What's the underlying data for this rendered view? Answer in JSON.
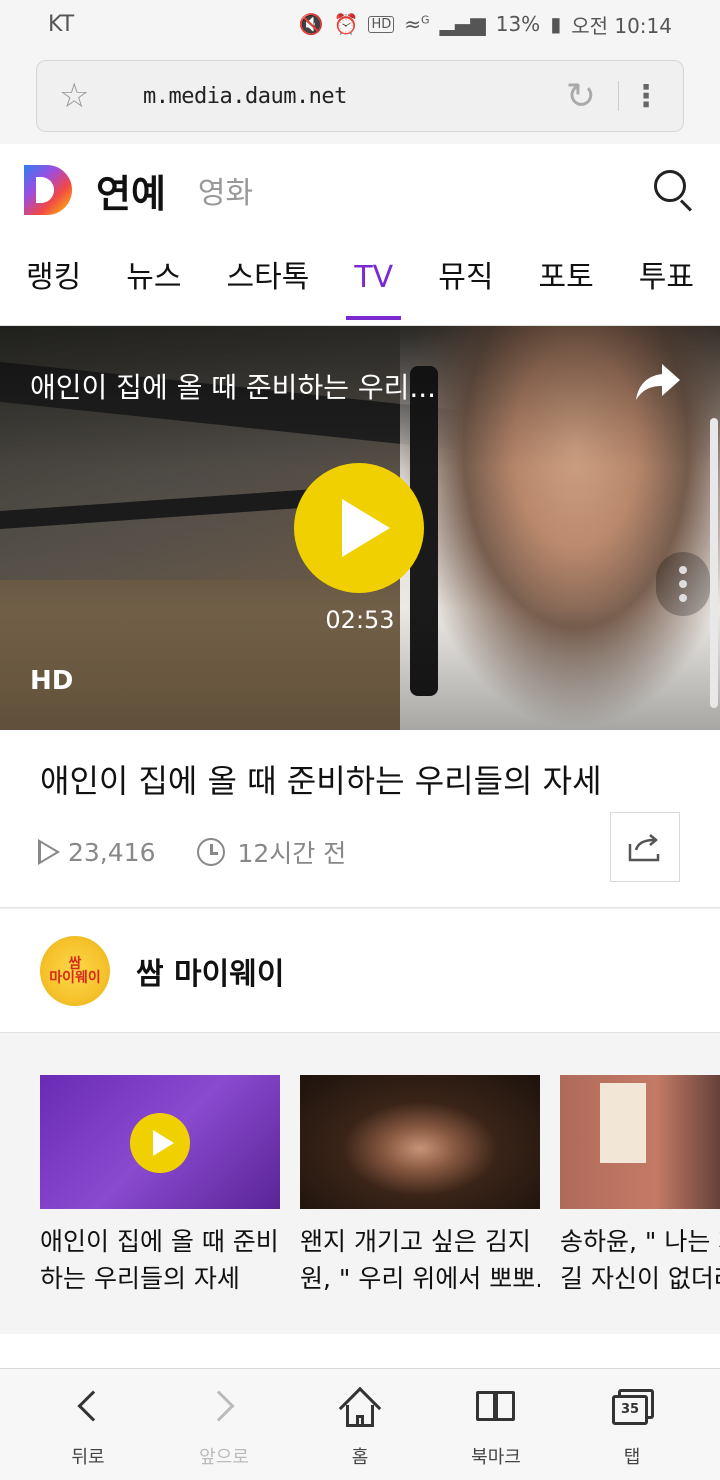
{
  "status_bar": {
    "carrier": "KT",
    "network": "G",
    "battery": "13%",
    "time": "오전 10:14",
    "icons": [
      "mute-icon",
      "alarm-icon",
      "hd-icon",
      "wifi-icon",
      "signal-icon",
      "battery-icon"
    ]
  },
  "browser": {
    "url": "m.media.daum.net"
  },
  "header": {
    "title": "연예",
    "subtitle": "영화"
  },
  "tabs": [
    {
      "label": "랭킹"
    },
    {
      "label": "뉴스"
    },
    {
      "label": "스타톡"
    },
    {
      "label": "TV",
      "active": true
    },
    {
      "label": "뮤직"
    },
    {
      "label": "포토"
    },
    {
      "label": "투표"
    }
  ],
  "video": {
    "title": "애인이 집에 올 때 준비하는 우리...",
    "duration": "02:53",
    "quality": "HD"
  },
  "article": {
    "title": "애인이 집에 올 때 준비하는 우리들의 자세",
    "views": "23,416",
    "time_ago": "12시간 전"
  },
  "channel": {
    "name": "쌈 마이웨이",
    "logo_text": "쌈\n마이웨이"
  },
  "related": [
    {
      "text": "애인이 집에 올 때 준비\n하는 우리들의 자세",
      "playing": true
    },
    {
      "text": "왠지 개기고 싶은 김지\n원, \" 우리 위에서 뽀뽀..."
    },
    {
      "text": "송하윤, \" 나는 자\n길 자신이 없더라"
    }
  ],
  "bottom_nav": [
    {
      "label": "뒤로"
    },
    {
      "label": "앞으로"
    },
    {
      "label": "홈"
    },
    {
      "label": "북마크"
    },
    {
      "label": "탭",
      "count": "35"
    }
  ],
  "colors": {
    "accent": "#7a2ad0",
    "play_yellow": "#f0d000"
  }
}
